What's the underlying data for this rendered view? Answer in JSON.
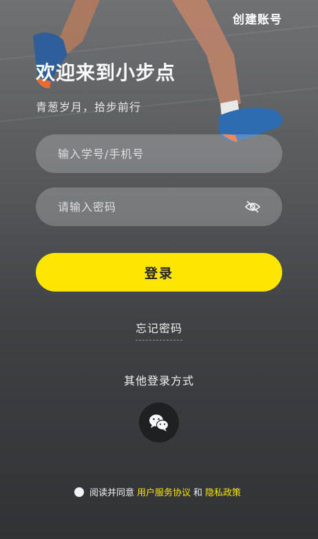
{
  "header": {
    "create_account": "创建账号"
  },
  "welcome": {
    "title": "欢迎来到小步点",
    "subtitle": "青葱岁月，拾步前行"
  },
  "form": {
    "account_placeholder": "输入学号/手机号",
    "password_placeholder": "请输入密码",
    "login_label": "登录",
    "forgot_label": "忘记密码"
  },
  "other_login": {
    "label": "其他登录方式",
    "icon": "wechat-icon"
  },
  "agreement": {
    "prefix": "阅读并同意",
    "terms": "用户服务协议",
    "and": "和",
    "privacy": "隐私政策"
  },
  "colors": {
    "accent": "#ffe600",
    "background": "#4a4e51"
  }
}
